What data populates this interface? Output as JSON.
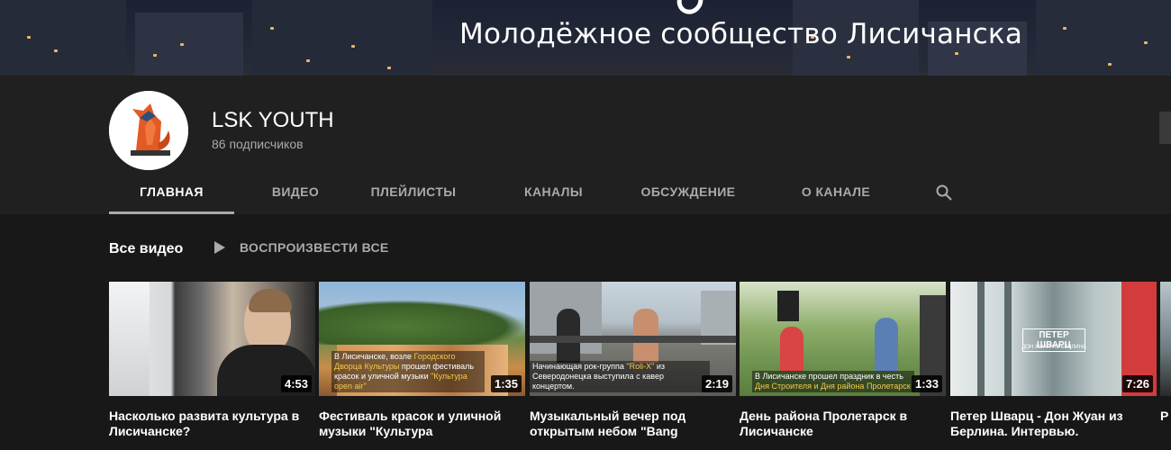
{
  "banner": {
    "title": "Молодёжное сообщество Лисичанска"
  },
  "channel": {
    "name": "LSK YOUTH",
    "subscribers": "86 подписчиков"
  },
  "tabs": [
    {
      "label": "ГЛАВНАЯ",
      "active": true
    },
    {
      "label": "ВИДЕО"
    },
    {
      "label": "ПЛЕЙЛИСТЫ"
    },
    {
      "label": "КАНАЛЫ"
    },
    {
      "label": "ОБСУЖДЕНИЕ"
    },
    {
      "label": "О КАНАЛЕ"
    }
  ],
  "section": {
    "title": "Все видео",
    "play_all": "ВОСПРОИЗВЕСТИ ВСЕ"
  },
  "videos": [
    {
      "title": "Насколько развита культура в Лисичанске?",
      "duration": "4:53"
    },
    {
      "title": "Фестиваль красок и уличной музыки \"Культура",
      "duration": "1:35",
      "caption_a": "В Лисичанске, возле ",
      "caption_hl1": "Городского Дворца Культуры",
      "caption_b": " прошел фестиваль красок и уличной музыки ",
      "caption_hl2": "\"Культура open air\""
    },
    {
      "title": "Музыкальный вечер под открытым небом \"Bang",
      "duration": "2:19",
      "caption_a": "Начинающая рок-группа ",
      "caption_hl1": "\"Roli-X\"",
      "caption_b": " из Северодонецка выступила с кавер концертом."
    },
    {
      "title": "День района Пролетарск в Лисичанске",
      "duration": "1:33",
      "caption_a": "В Лисичанске прошел праздник в честь ",
      "caption_hl1": "Дня Строителя и Дня района Пролетарск"
    },
    {
      "title": "Петер Шварц - Дон Жуан из Берлина. Интервью.",
      "duration": "7:26",
      "overlay_title": "ПЕТЕР ШВАРЦ",
      "overlay_sub": "ДОН ЖУАН ИЗ БЕРЛИНА"
    }
  ],
  "partial_video": {
    "title_start": "Р"
  },
  "icons": {
    "search": "search-icon",
    "play": "play-icon"
  }
}
